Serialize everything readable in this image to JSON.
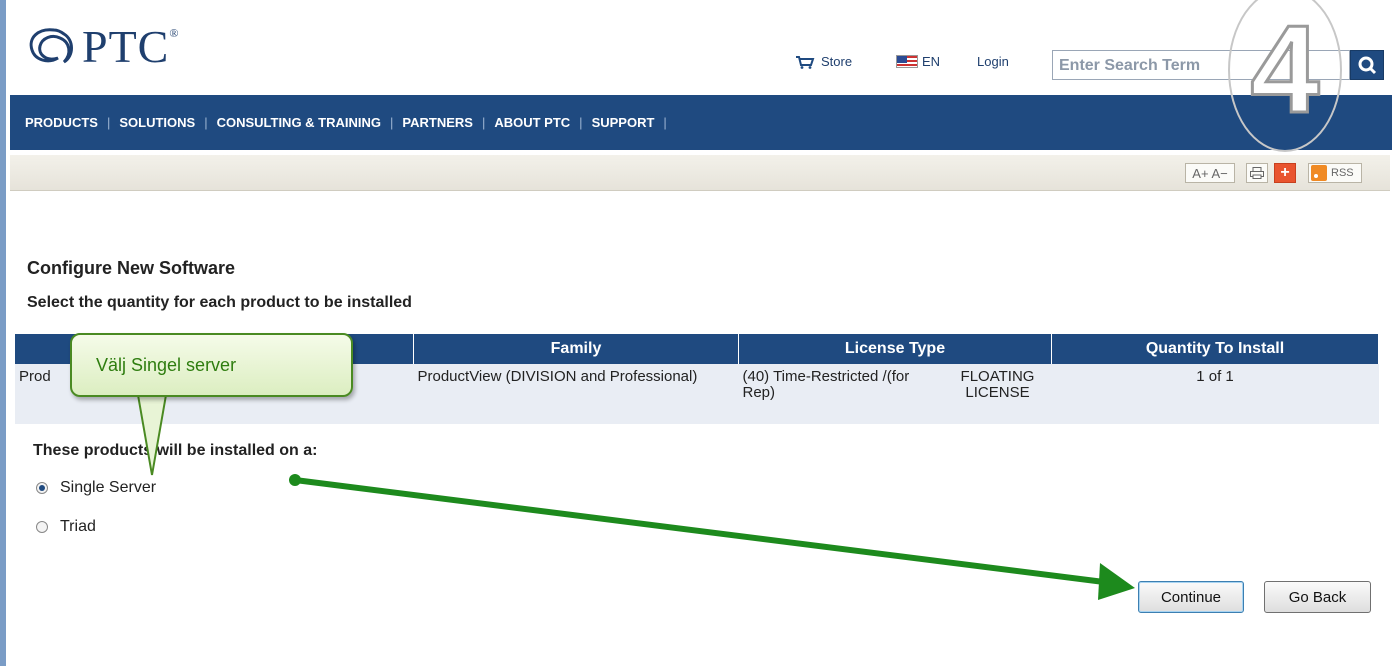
{
  "header": {
    "logo_text": "PTC",
    "logo_reg": "®",
    "store_label": "Store",
    "lang_label": "EN",
    "login_label": "Login",
    "search_placeholder": "Enter Search Term"
  },
  "nav": {
    "items": [
      "PRODUCTS",
      "SOLUTIONS",
      "CONSULTING & TRAINING",
      "PARTNERS",
      "ABOUT PTC",
      "SUPPORT"
    ],
    "separator": "|"
  },
  "toolbar": {
    "font_size_label": "A+ A−",
    "share_label": "+",
    "rss_label": "RSS"
  },
  "step_number": "4",
  "page": {
    "title": "Configure New Software",
    "subtitle": "Select the quantity for each product to be installed"
  },
  "table": {
    "headers": [
      "",
      "Family",
      "License Type",
      "Quantity To Install"
    ],
    "row": {
      "product": "Prod",
      "family": "ProductView (DIVISION and Professional)",
      "license_term": "(40) Time-Restricted /(for Rep)",
      "license_kind": "FLOATING LICENSE",
      "quantity": "1 of 1"
    }
  },
  "install": {
    "question": "These products will be installed on a:",
    "options": [
      {
        "label": "Single Server",
        "checked": true
      },
      {
        "label": "Triad",
        "checked": false
      }
    ]
  },
  "buttons": {
    "continue": "Continue",
    "back": "Go Back"
  },
  "callout": {
    "text": "Välj Singel server"
  },
  "colors": {
    "nav_blue": "#1f4a80",
    "annotation_green": "#1d8a1d"
  }
}
